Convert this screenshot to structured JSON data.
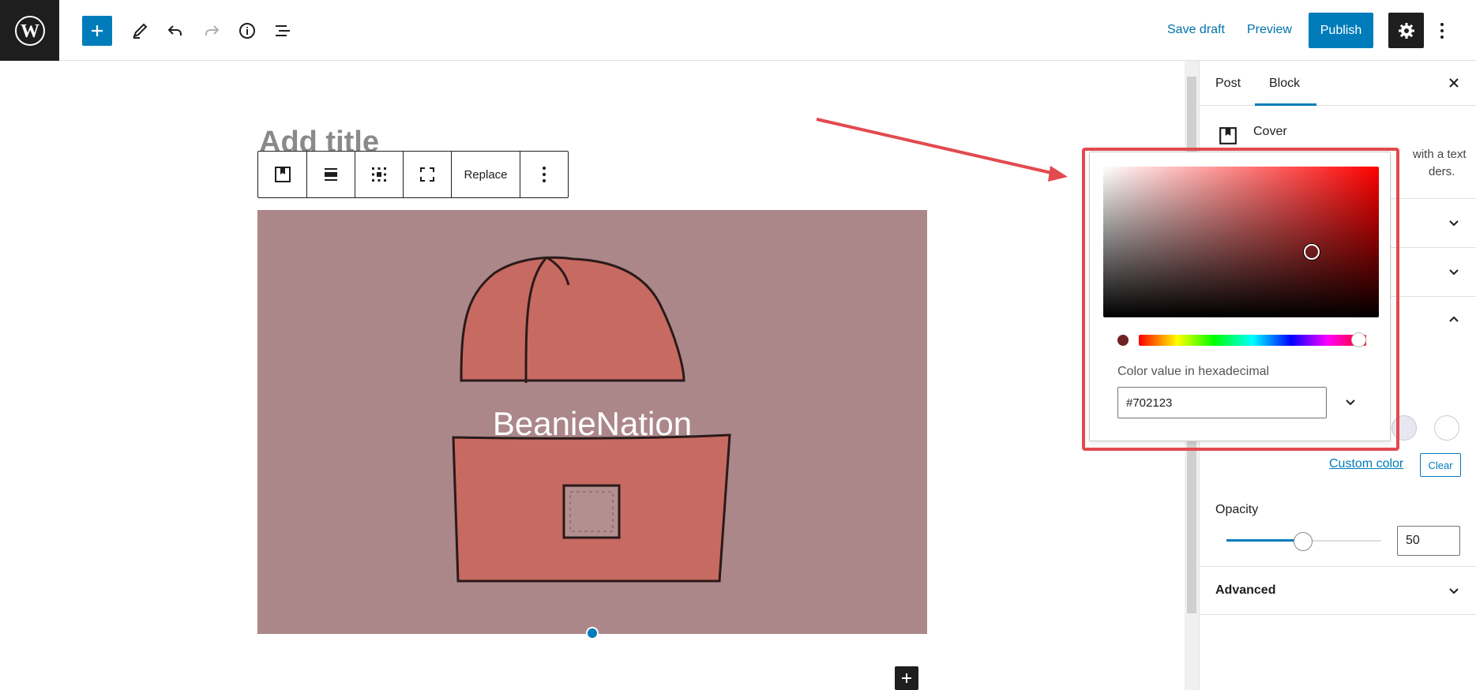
{
  "toolbar": {
    "save_draft": "Save draft",
    "preview": "Preview",
    "publish": "Publish"
  },
  "editor": {
    "title_placeholder": "Add title",
    "block_toolbar": {
      "replace": "Replace"
    },
    "cover_text": "BeanieNation"
  },
  "sidebar": {
    "tabs": [
      "Post",
      "Block"
    ],
    "active_tab": "Block",
    "block": {
      "name": "Cover",
      "description_fragments": [
        "with a text",
        "ders."
      ]
    },
    "color": {
      "custom_color": "Custom color",
      "clear": "Clear"
    },
    "opacity": {
      "label": "Opacity",
      "value": "50"
    },
    "advanced": "Advanced"
  },
  "color_picker": {
    "hex_label": "Color value in hexadecimal",
    "hex_value": "#702123"
  },
  "colors": {
    "accent": "#007cba",
    "cover_overlay": "#ab878a",
    "selected_color": "#702123",
    "annotation": "#e24a4f"
  }
}
